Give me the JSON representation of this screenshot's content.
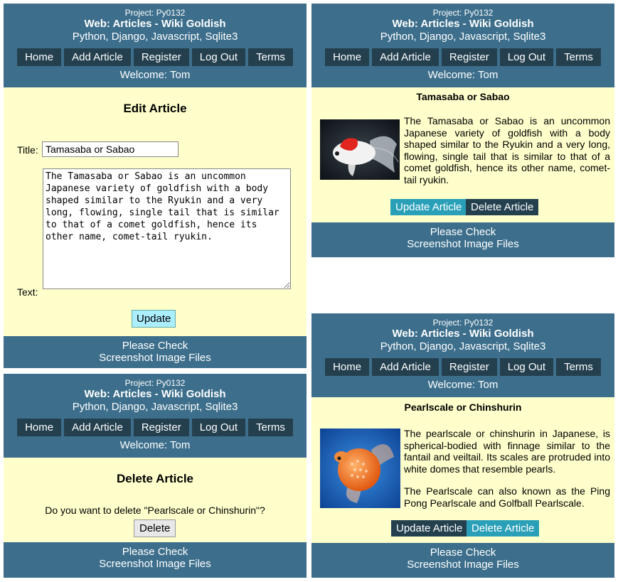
{
  "header": {
    "project": "Project: Py0132",
    "site_title": "Web: Articles - Wiki Goldish",
    "tech": "Python, Django, Javascript, Sqlite3",
    "nav": [
      "Home",
      "Add Article",
      "Register",
      "Log Out",
      "Terms"
    ],
    "welcome": "Welcome: Tom"
  },
  "footer": {
    "line1": "Please Check",
    "line2": "Screenshot Image Files"
  },
  "edit_panel": {
    "heading": "Edit Article",
    "title_label": "Title:",
    "title_value": "Tamasaba or Sabao",
    "text_label": "Text:",
    "text_value": "The Tamasaba or Sabao is an uncommon Japanese variety of goldfish with a body shaped similar to the Ryukin and a very long, flowing, single tail that is similar to that of a comet goldfish, hence its other name, comet-tail ryukin.",
    "update_label": "Update"
  },
  "delete_panel": {
    "heading": "Delete Article",
    "question": "Do you want to delete \"Pearlscale or Chinshurin\"?",
    "delete_label": "Delete"
  },
  "article1": {
    "title": "Tamasaba or Sabao",
    "paragraphs": [
      "The Tamasaba or Sabao is an uncommon Japanese variety of goldfish with a body shaped similar to the Ryukin and a very long, flowing, single tail that is similar to that of a comet goldfish, hence its other name, comet-tail ryukin."
    ],
    "update_label": "Update Article",
    "delete_label": "Delete Article"
  },
  "article2": {
    "title": "Pearlscale or Chinshurin",
    "paragraphs": [
      "The pearlscale or chinshurin in Japanese, is spherical-bodied with finnage similar to the fantail and veiltail. Its scales are protruded into white domes that resemble pearls.",
      "The Pearlscale can also known as the Ping Pong Pearlscale and Golfball Pearlscale."
    ],
    "update_label": "Update Article",
    "delete_label": "Delete Article"
  },
  "colors": {
    "header": "#3d6f8c",
    "nav_button": "#24404f",
    "content_bg": "#ffffcc",
    "accent_teal": "#2aa0b8"
  }
}
